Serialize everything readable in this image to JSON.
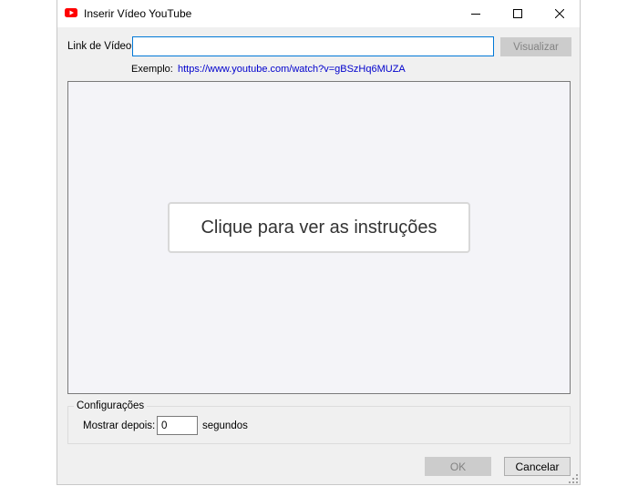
{
  "window": {
    "title": "Inserir Vídeo YouTube"
  },
  "form": {
    "link_label": "Link de Vídeo:",
    "link_value": "",
    "preview_button": "Visualizar",
    "example_label": "Exemplo:",
    "example_url": "https://www.youtube.com/watch?v=gBSzHq6MUZA"
  },
  "preview": {
    "instructions_button": "Clique para ver as instruções"
  },
  "settings": {
    "legend": "Configurações",
    "show_after_label": "Mostrar depois:",
    "show_after_value": "0",
    "seconds_label": "segundos"
  },
  "footer": {
    "ok": "OK",
    "cancel": "Cancelar"
  },
  "colors": {
    "youtube_red": "#ff0000",
    "focus_blue": "#0078d7",
    "link_blue": "#0000cc"
  }
}
